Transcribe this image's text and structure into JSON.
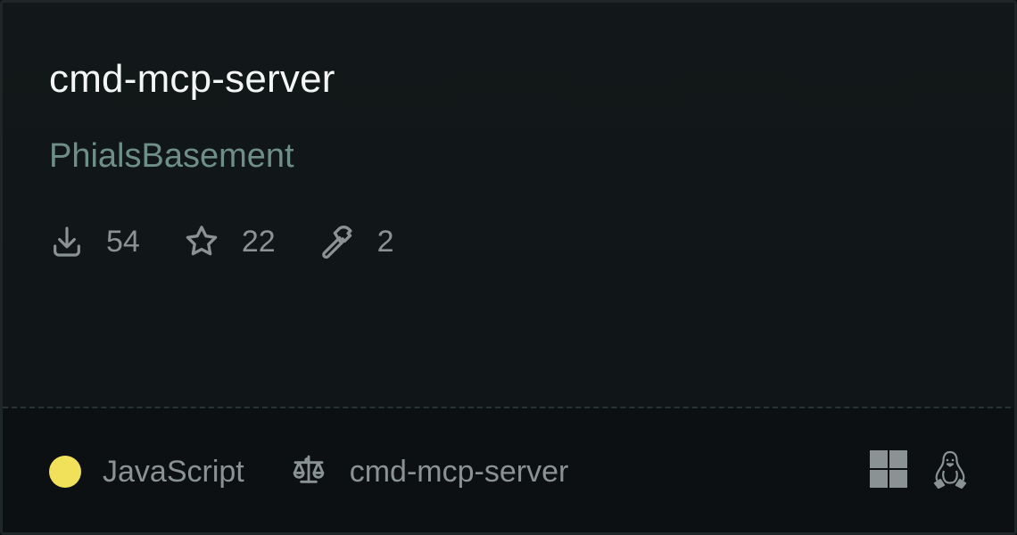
{
  "repo": {
    "name": "cmd-mcp-server",
    "owner": "PhialsBasement"
  },
  "stats": {
    "downloads": "54",
    "stars": "22",
    "tools": "2"
  },
  "footer": {
    "language": "JavaScript",
    "language_color": "#f1e05a",
    "license_label": "cmd-mcp-server"
  },
  "icons": {
    "downloads": "download-icon",
    "stars": "star-icon",
    "tools": "hammer-icon",
    "license": "scale-icon",
    "platform_windows": "windows-icon",
    "platform_linux": "linux-icon"
  },
  "colors": {
    "background": "#121819",
    "title": "#f4f6f6",
    "owner": "#6e8f86",
    "muted": "#8a9294"
  }
}
